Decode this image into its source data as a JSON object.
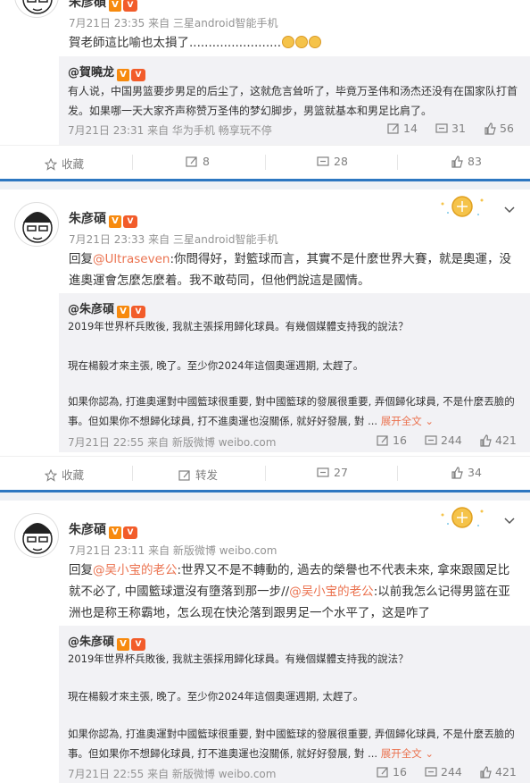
{
  "post0": {
    "username": "朱彦碩",
    "meta": "7月21日 23:35 来自 三星android智能手机",
    "text": "賀老師這比喻也太損了........................",
    "quote": {
      "username": "@賀曉龙",
      "text": "有人说，中国男篮要步男足的后尘了，这就危言耸听了，毕竟万圣伟和汤杰还没有在国家队打首发。如果哪一天大家齐声称赞万圣伟的梦幻脚步，男篮就基本和男足比肩了。",
      "meta": "7月21日 23:31 来自 华为手机 畅享玩不停",
      "reposts": "14",
      "comments": "31",
      "likes": "56"
    },
    "actions": {
      "fav": "收藏",
      "repost": "8",
      "comment": "28",
      "like": "83"
    }
  },
  "post1": {
    "username": "朱彦碩",
    "meta": "7月21日 23:33 来自 三星android智能手机",
    "reply_prefix": "回复",
    "mention": "@Ultraseven",
    "text": ":你問得好，對籃球而言，其實不是什麼世界大賽，就是奧運，没進奧運會怎麼怎麼着。我不敢苟同，但他們說這是國情。",
    "quote": {
      "username": "@朱彦碩",
      "p1": "2019年世界杯兵敗後, 我就主張採用歸化球員。有幾個媒體支持我的說法？",
      "p2": "現在楊毅才來主張, 晚了。至少你2024年這個奧運週期, 太趕了。",
      "p3": "如果你認為, 打進奧運對中國籃球很重要, 對中國籃球的發展很重要, 弄個歸化球員, 不是什麼丟臉的事。但如果你不想歸化球員, 打不進奧運也沒關係, 就好好發展, 對 ...",
      "expand": "展开全文",
      "meta": "7月21日 22:55 来自 新版微博 weibo.com",
      "reposts": "16",
      "comments": "244",
      "likes": "421"
    },
    "actions": {
      "fav": "收藏",
      "repost": "转发",
      "comment": "27",
      "like": "34"
    }
  },
  "post2": {
    "username": "朱彦碩",
    "meta": "7月21日 23:11 来自 新版微博 weibo.com",
    "reply_prefix": "回复",
    "mention1": "@吴小宝的老公",
    "text1": ":世界又不是不轉動的, 過去的榮譽也不代表未來, 拿來跟國足比就不必了, 中國籃球還沒有墮落到那一步//",
    "mention2": "@吴小宝的老公",
    "text2": ":以前我怎么记得男篮在亚洲也是称王称霸地，怎么现在快沦落到跟男足一个水平了，这是咋了",
    "quote": {
      "username": "@朱彦碩",
      "p1": "2019年世界杯兵敗後, 我就主張採用歸化球員。有幾個媒體支持我的說法？",
      "p2": "現在楊毅才來主張, 晚了。至少你2024年這個奧運週期, 太趕了。",
      "p3": "如果你認為, 打進奧運對中國籃球很重要, 對中國籃球的發展很重要, 弄個歸化球員, 不是什麼丟臉的事。但如果你不想歸化球員, 打不進奧運也沒關係, 就好好發展, 對 ...",
      "expand": "展开全文",
      "meta": "7月21日 22:55 来自 新版微博 weibo.com",
      "reposts": "16",
      "comments": "244",
      "likes": "421"
    }
  },
  "badges": {
    "verified": "V",
    "level": "V"
  },
  "colors": {
    "link": "#eb7350",
    "accent_bar": "#2d77c1",
    "quote_bg": "#f2f2f5"
  }
}
